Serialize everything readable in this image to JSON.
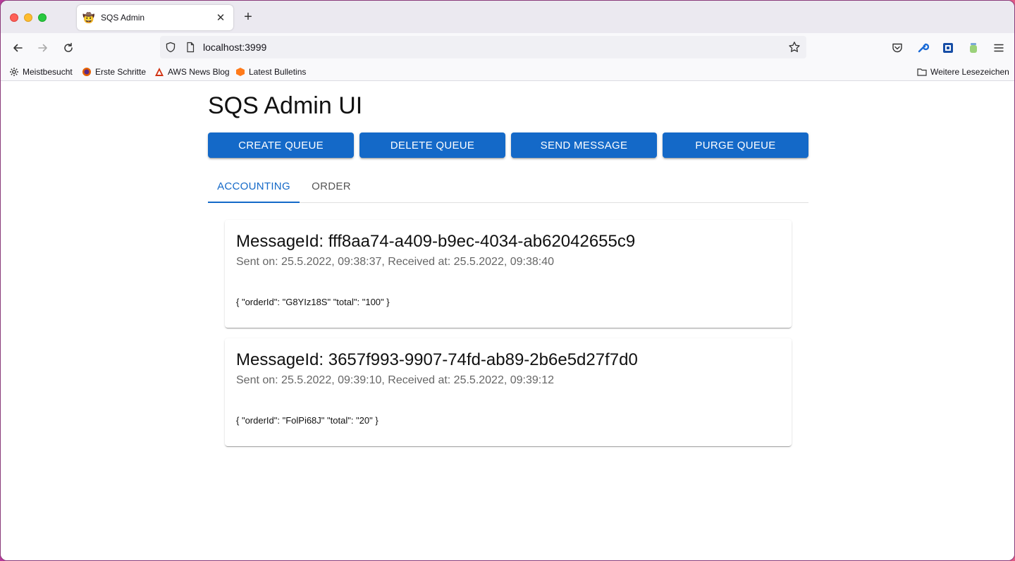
{
  "browser": {
    "tab_title": "SQS Admin",
    "url": "localhost:3999",
    "bookmarks": [
      "Meistbesucht",
      "Erste Schritte",
      "AWS News Blog",
      "Latest Bulletins"
    ],
    "other_bookmarks": "Weitere Lesezeichen"
  },
  "page": {
    "title": "SQS Admin UI",
    "actions": {
      "create": "CREATE QUEUE",
      "delete": "DELETE QUEUE",
      "send": "SEND MESSAGE",
      "purge": "PURGE QUEUE"
    },
    "queue_tabs": [
      "ACCOUNTING",
      "ORDER"
    ],
    "messages": [
      {
        "id": "MessageId: fff8aa74-a409-b9ec-4034-ab62042655c9",
        "meta": "Sent on: 25.5.2022, 09:38:37, Received at: 25.5.2022, 09:38:40",
        "body": "{ \"orderId\": \"G8YIz18S\" \"total\": \"100\" }"
      },
      {
        "id": "MessageId: 3657f993-9907-74fd-ab89-2b6e5d27f7d0",
        "meta": "Sent on: 25.5.2022, 09:39:10, Received at: 25.5.2022, 09:39:12",
        "body": "{ \"orderId\": \"FolPi68J\" \"total\": \"20\" }"
      }
    ]
  },
  "colors": {
    "primary": "#1469c8",
    "tabstrip": "#ebe9f0",
    "toolbar": "#f9f9fb"
  },
  "icons": {
    "tab_favicon": "cowboy-hat-icon",
    "back": "arrow-left-icon",
    "forward": "arrow-right-icon",
    "reload": "reload-icon",
    "shield": "shield-icon",
    "page": "page-icon",
    "star": "star-icon",
    "pocket": "pocket-icon",
    "menu": "hamburger-icon"
  }
}
